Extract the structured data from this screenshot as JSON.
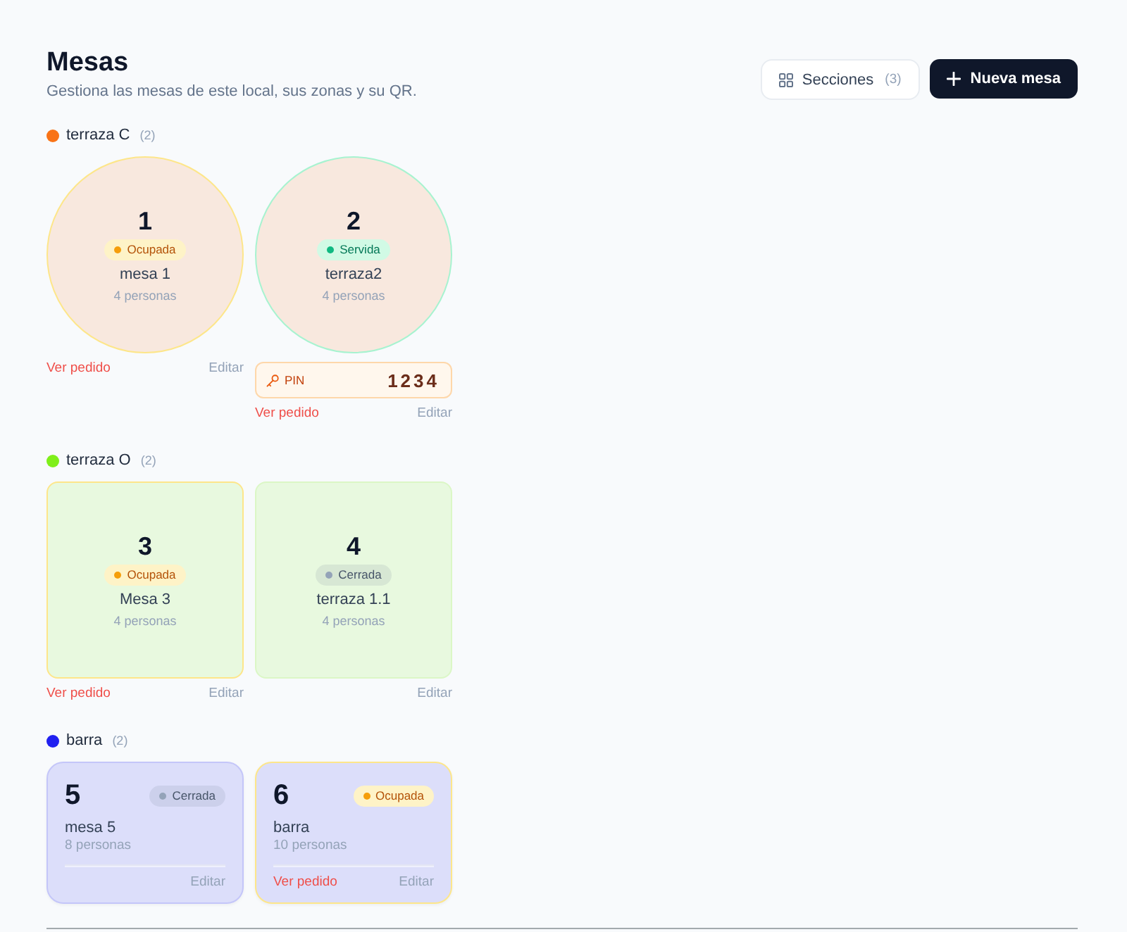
{
  "header": {
    "title": "Mesas",
    "subtitle": "Gestiona las mesas de este local, sus zonas y su QR."
  },
  "toolbar": {
    "sections_button": {
      "label": "Secciones",
      "count": "(3)"
    },
    "new_table_button": {
      "label": "Nueva mesa"
    }
  },
  "sections": [
    {
      "name": "terraza C",
      "count": "(2)",
      "color": "#f97316",
      "kind": "round",
      "tables": [
        {
          "number": "1",
          "status": {
            "kind": "occupied",
            "label": "Ocupada"
          },
          "name": "mesa 1",
          "capacity": "4 personas",
          "view_order": "Ver pedido",
          "edit": "Editar"
        },
        {
          "number": "2",
          "status": {
            "kind": "served",
            "label": "Servida"
          },
          "name": "terraza2",
          "capacity": "4 personas",
          "pin": {
            "label": "PIN",
            "code": "1234"
          },
          "view_order": "Ver pedido",
          "edit": "Editar"
        }
      ]
    },
    {
      "name": "terraza O",
      "count": "(2)",
      "color": "#7fef1a",
      "kind": "square",
      "tables": [
        {
          "number": "3",
          "status": {
            "kind": "occupied",
            "label": "Ocupada"
          },
          "name": "Mesa 3",
          "capacity": "4 personas",
          "view_order": "Ver pedido",
          "edit": "Editar"
        },
        {
          "number": "4",
          "status": {
            "kind": "closed",
            "label": "Cerrada"
          },
          "name": "terraza 1.1",
          "capacity": "4 personas",
          "edit": "Editar"
        }
      ]
    },
    {
      "name": "barra",
      "count": "(2)",
      "color": "#2020f0",
      "kind": "card",
      "tables": [
        {
          "number": "5",
          "status": {
            "kind": "closed",
            "label": "Cerrada"
          },
          "name": "mesa 5",
          "capacity": "8 personas",
          "edit": "Editar"
        },
        {
          "number": "6",
          "status": {
            "kind": "occupied",
            "label": "Ocupada"
          },
          "name": "barra",
          "capacity": "10 personas",
          "view_order": "Ver pedido",
          "edit": "Editar"
        }
      ]
    }
  ]
}
